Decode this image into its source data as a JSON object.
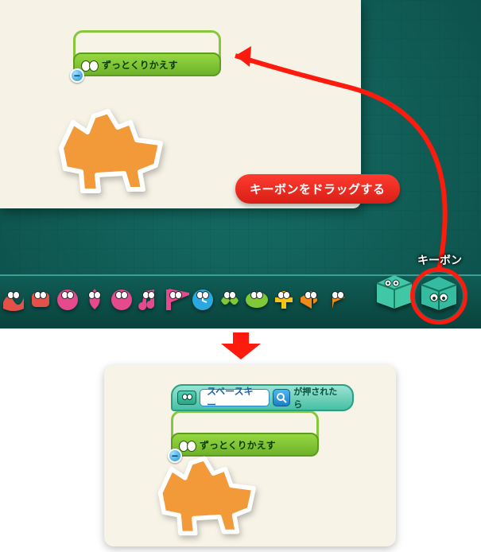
{
  "annotations": {
    "drag_instruction": "キーボンをドラッグする",
    "kibon_name": "キーボン"
  },
  "block": {
    "repeat_label": "ずっとくりかえす",
    "minus": "−"
  },
  "input_block": {
    "key_name": "スペースキー",
    "suffix": "が押されたら"
  },
  "toolbar": {
    "items": [
      {
        "name": "wave",
        "color": "#e2514a"
      },
      {
        "name": "plus-red",
        "color": "#e2514a"
      },
      {
        "name": "loop",
        "color": "#e44a8d"
      },
      {
        "name": "drop",
        "color": "#e44a8d"
      },
      {
        "name": "swirl",
        "color": "#e44a8d"
      },
      {
        "name": "note",
        "color": "#e44a8d"
      },
      {
        "name": "flag",
        "color": "#e44a8d"
      },
      {
        "name": "clock",
        "color": "#2aa9e0"
      },
      {
        "name": "infinity",
        "color": "#7fc938"
      },
      {
        "name": "eye",
        "color": "#7fc938"
      },
      {
        "name": "plus-yellow",
        "color": "#f2c31a"
      },
      {
        "name": "megaphone",
        "color": "#f28a1a"
      },
      {
        "name": "marker",
        "color": "#f28a1a"
      }
    ]
  }
}
